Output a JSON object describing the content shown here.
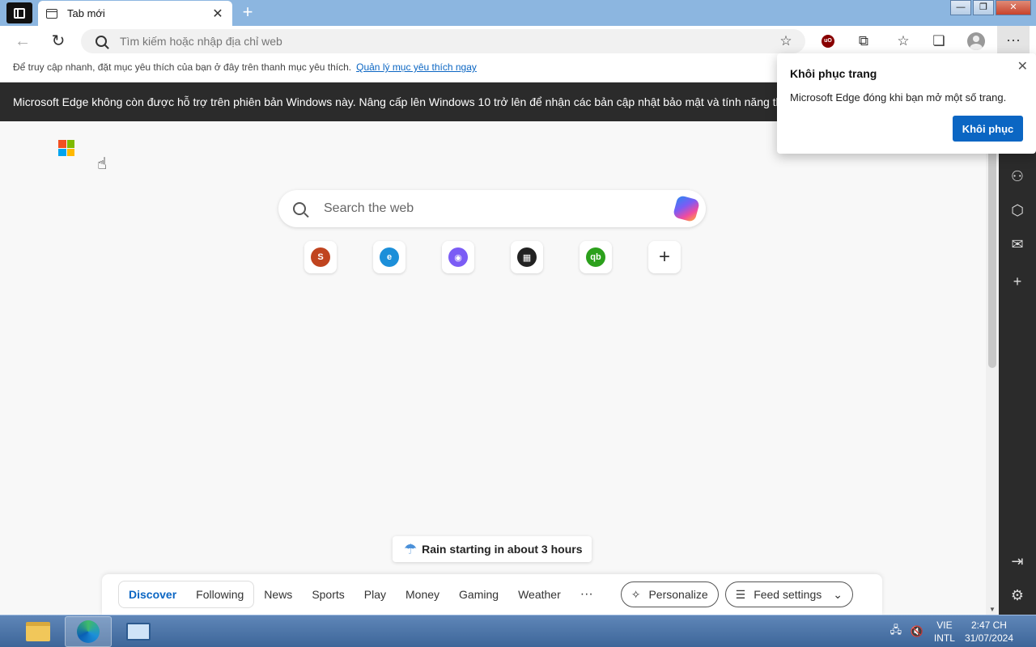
{
  "browser": {
    "tab": {
      "title": "Tab mới"
    },
    "address_bar": {
      "placeholder": "Tìm kiếm hoặc nhập địa chỉ web"
    }
  },
  "favorites_bar": {
    "text": "Để truy cập nhanh, đặt mục yêu thích của bạn ở đây trên thanh mục yêu thích.",
    "link": "Quản lý mục yêu thích ngay"
  },
  "info_bar": {
    "text": "Microsoft Edge không còn được hỗ trợ trên phiên bản Windows này. Nâng cấp lên Windows 10 trở lên để nhận các bản cập nhật bảo mật và tính năng thường xuyên"
  },
  "newtab": {
    "search_placeholder": "Search the web",
    "quick_links": [
      {
        "name": "s-site",
        "glyph": "S",
        "color": "#c0441f"
      },
      {
        "name": "edge-site",
        "glyph": "e",
        "color": "#1c8fd9"
      },
      {
        "name": "copilot-site",
        "glyph": "◉",
        "color": "#7b5cf5"
      },
      {
        "name": "store-site",
        "glyph": "▦",
        "color": "#222222"
      },
      {
        "name": "quickbooks-site",
        "glyph": "qb",
        "color": "#2ca01c"
      }
    ],
    "weather": "Rain starting in about 3 hours"
  },
  "feed": {
    "tabs": [
      "Discover",
      "Following"
    ],
    "items": [
      "News",
      "Sports",
      "Play",
      "Money",
      "Gaming",
      "Weather"
    ],
    "more": "···",
    "personalize": "Personalize",
    "feed_settings": "Feed settings"
  },
  "popup": {
    "title": "Khôi phục trang",
    "message": "Microsoft Edge đóng khi bạn mở một số trang.",
    "button": "Khôi phục"
  },
  "taskbar": {
    "lang_top": "VIE",
    "lang_bottom": "INTL",
    "time": "2:47 CH",
    "date": "31/07/2024"
  },
  "colors": {
    "accent": "#0b66c3",
    "infobar": "#2b2b2b"
  }
}
